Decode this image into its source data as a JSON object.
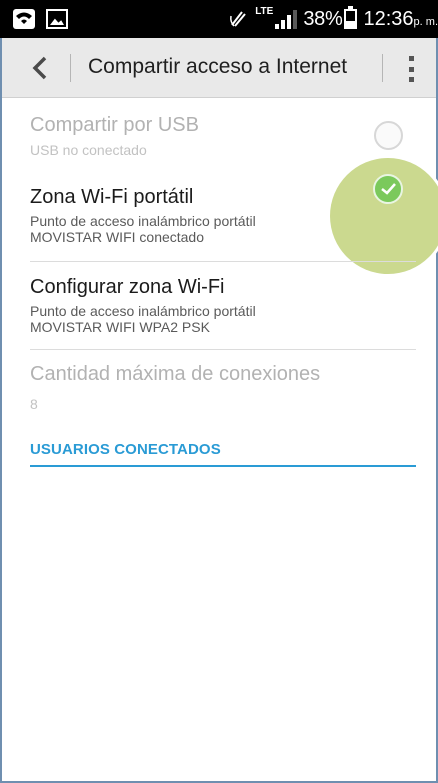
{
  "status_bar": {
    "battery": "38%",
    "time": "12:36",
    "ampm": "p. m.",
    "network": "LTE",
    "icons": [
      "wifi-icon",
      "image-icon",
      "nfc-icon",
      "signal-icon",
      "battery-icon"
    ]
  },
  "action_bar": {
    "title": "Compartir acceso a Internet",
    "icons": [
      "back-icon",
      "overflow-menu-icon"
    ]
  },
  "prefs": [
    {
      "title": "Compartir por USB",
      "summary": "USB no conectado",
      "enabled": false,
      "checked": false
    },
    {
      "title": "Zona Wi-Fi portátil",
      "summary_line1": "Punto de acceso inalámbrico portátil",
      "summary_line2": "MOVISTAR WIFI conectado",
      "enabled": true,
      "checked": true
    },
    {
      "title": "Configurar zona Wi-Fi",
      "summary_line1": "Punto de acceso inalámbrico portátil",
      "summary_line2": "MOVISTAR WIFI WPA2 PSK",
      "enabled": true
    },
    {
      "title": "Cantidad máxima de conexiones",
      "summary": "8",
      "enabled": false
    }
  ],
  "section": {
    "title": "USUARIOS CONECTADOS"
  },
  "colors": {
    "accent": "#2a9bd5",
    "check": "#7bc95c",
    "ripple": "#cbd98f"
  }
}
